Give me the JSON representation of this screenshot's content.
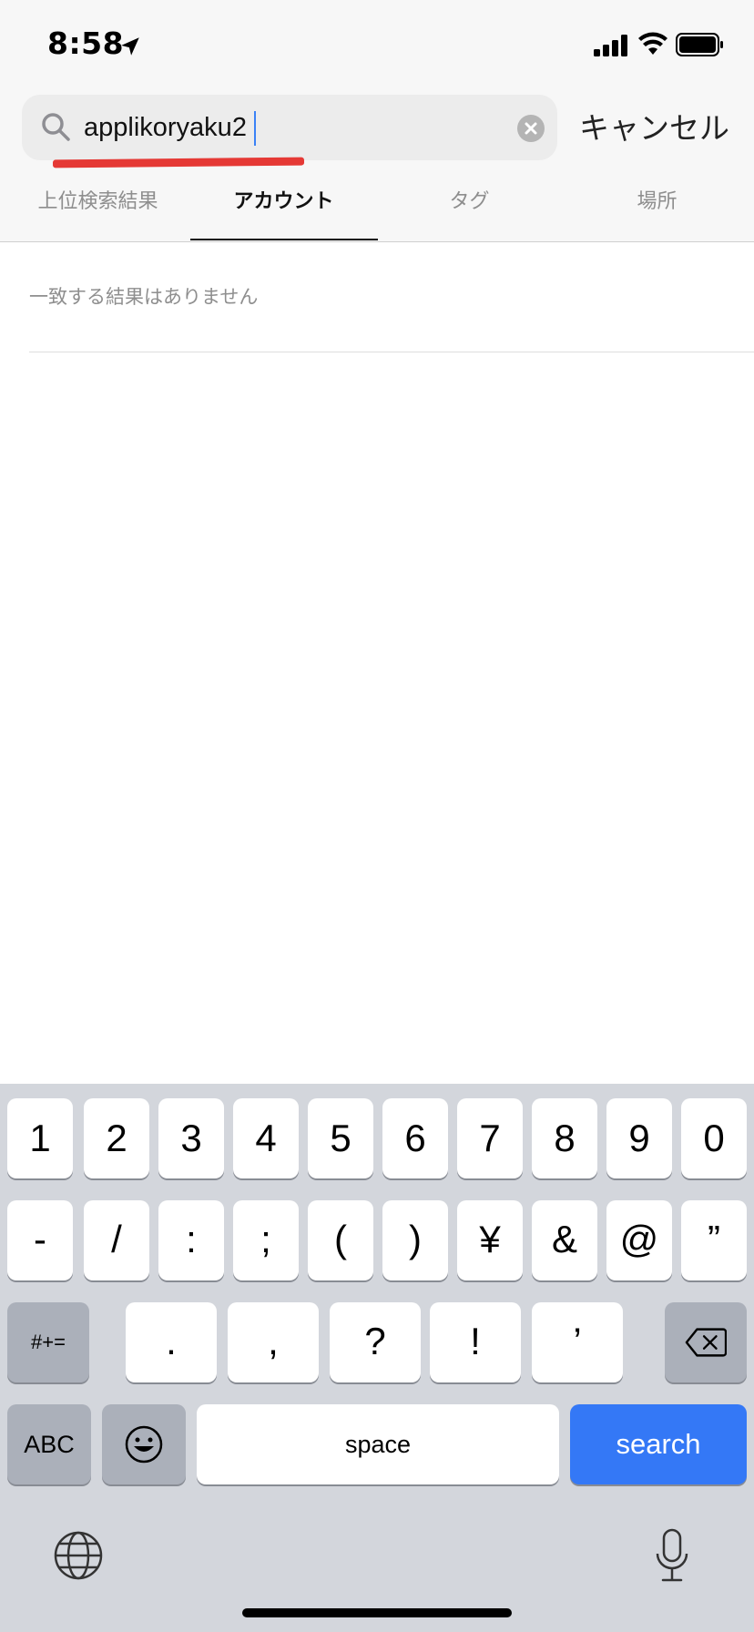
{
  "status_bar": {
    "time": "8:58",
    "icons": [
      "location-arrow-icon",
      "cellular-signal-icon",
      "wifi-icon",
      "battery-icon"
    ]
  },
  "search": {
    "query": "applikoryaku2",
    "cancel_label": "キャンセル",
    "icons": [
      "search-icon",
      "clear-icon"
    ],
    "annotation_color": "#e53935"
  },
  "tabs": [
    {
      "label": "上位検索結果",
      "active": false
    },
    {
      "label": "アカウント",
      "active": true
    },
    {
      "label": "タグ",
      "active": false
    },
    {
      "label": "場所",
      "active": false
    }
  ],
  "results": {
    "empty_message": "一致する結果はありません"
  },
  "keyboard": {
    "row_numbers": [
      "1",
      "2",
      "3",
      "4",
      "5",
      "6",
      "7",
      "8",
      "9",
      "0"
    ],
    "row_symbols": [
      "-",
      "/",
      ":",
      ";",
      "(",
      ")",
      "¥",
      "&",
      "@",
      "”"
    ],
    "row_punct": {
      "mode_label": "#+=",
      "keys": [
        ".",
        ",",
        "?",
        "!",
        "’"
      ],
      "delete_icon": "backspace-icon"
    },
    "row_bottom": {
      "abc_label": "ABC",
      "emoji_icon": "emoji-icon",
      "space_label": "space",
      "search_label": "search"
    },
    "extra_icons": [
      "globe-icon",
      "microphone-icon"
    ],
    "search_key_color": "#3478f6"
  }
}
